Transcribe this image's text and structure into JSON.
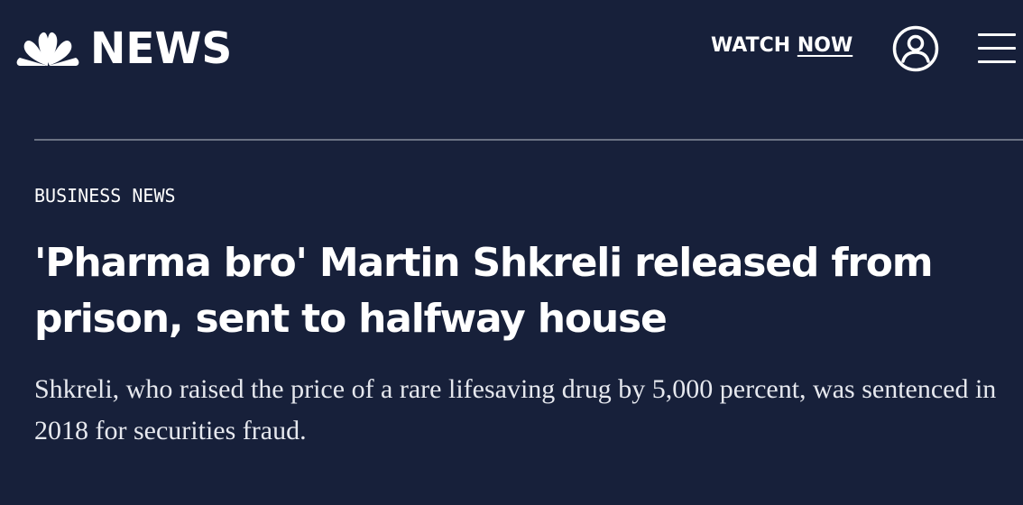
{
  "header": {
    "logo_text": "NEWS",
    "watch_label": "WATCH",
    "watch_now": "NOW",
    "account_icon": "user-circle-icon",
    "menu_icon": "hamburger-menu-icon"
  },
  "article": {
    "section": "BUSINESS NEWS",
    "headline": "'Pharma bro' Martin Shkreli released from prison, sent to halfway house",
    "dek": "Shkreli, who raised the price of a rare lifesaving drug by 5,000 percent, was sentenced in 2018 for securities fraud."
  },
  "colors": {
    "background": "#17203a",
    "text": "#ffffff",
    "divider": "#6b7283"
  }
}
